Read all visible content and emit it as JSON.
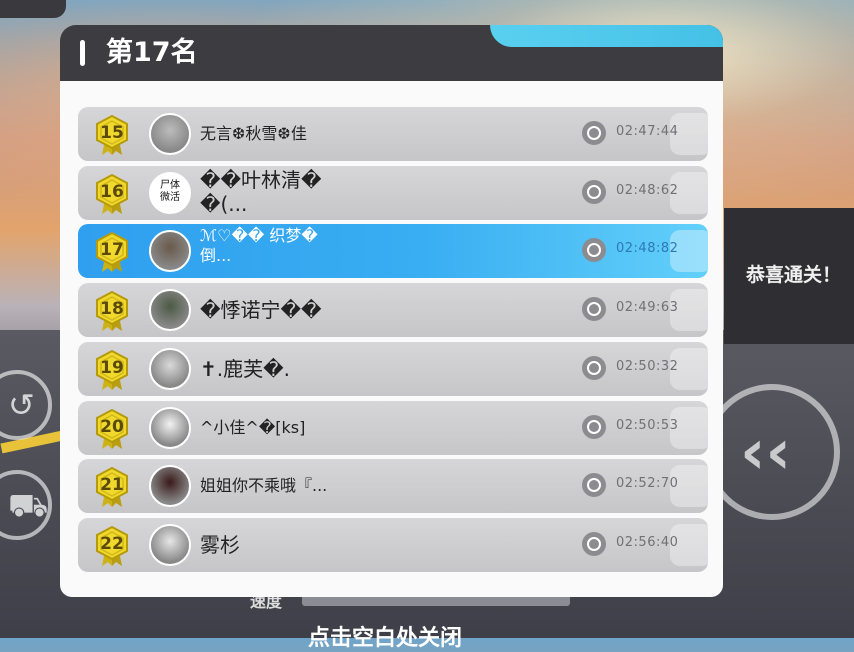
{
  "panel": {
    "title": "第17名"
  },
  "rankings": [
    {
      "rank": "15",
      "name": "无言❆秋雪❆佳",
      "time": "02:47:44",
      "me": false,
      "avatar_text": ""
    },
    {
      "rank": "16",
      "name": "��叶林清�\n�(...",
      "time": "02:48:62",
      "me": false,
      "avatar_text": "尸体\n微活"
    },
    {
      "rank": "17",
      "name": "ℳ♡�� 织梦�\n倒...",
      "time": "02:48:82",
      "me": true,
      "avatar_text": ""
    },
    {
      "rank": "18",
      "name": "�悸诺宁��",
      "time": "02:49:63",
      "me": false,
      "avatar_text": ""
    },
    {
      "rank": "19",
      "name": "✝.鹿芙�.",
      "time": "02:50:32",
      "me": false,
      "avatar_text": ""
    },
    {
      "rank": "20",
      "name": "^小佳^�[ks]",
      "time": "02:50:53",
      "me": false,
      "avatar_text": ""
    },
    {
      "rank": "21",
      "name": "姐姐你不乘哦『...",
      "time": "02:52:70",
      "me": false,
      "avatar_text": ""
    },
    {
      "rank": "22",
      "name": "雾杉",
      "time": "02:56:40",
      "me": false,
      "avatar_text": ""
    }
  ],
  "background": {
    "side_message": "恭喜通关！",
    "speed_label": "速度",
    "close_hint": "点击空白处关闭"
  },
  "icons": {
    "medal": "laurel-medal-icon",
    "clock": "alarm-clock-icon",
    "back": "double-chevron-left-icon"
  },
  "colors": {
    "header": "#3d3d41",
    "accent": "#4cc6ec",
    "highlight_row": "#39aef2",
    "medal_gold": "#e6cf2a"
  }
}
